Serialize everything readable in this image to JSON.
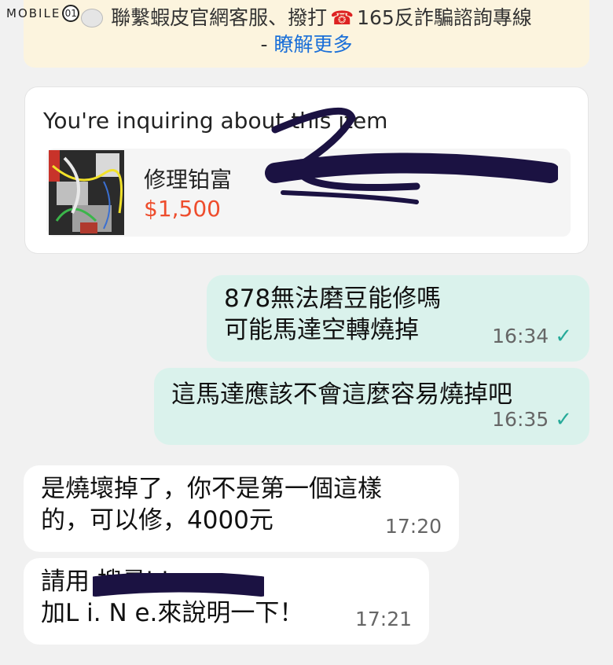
{
  "watermark": {
    "text": "MOBILE",
    "badge": "01"
  },
  "notice": {
    "line1_before": "聯繫蝦皮官網客服、撥打",
    "phone_icon": "☎",
    "line1_after": "165反詐騙諮詢專線",
    "dash": "- ",
    "link": "瞭解更多"
  },
  "item_card": {
    "heading": "You're inquiring about this item",
    "product_name": "修理铂富",
    "price": "$1,500"
  },
  "messages": [
    {
      "direction": "out",
      "text": "878無法磨豆能修嗎\n可能馬達空轉燒掉",
      "time": "16:34",
      "status": "✓"
    },
    {
      "direction": "out",
      "text": "這馬達應該不會這麼容易燒掉吧",
      "time": "16:35",
      "status": "✓"
    },
    {
      "direction": "in",
      "text": "是燒壞掉了，你不是第一個這樣\n的，可以修，4000元",
      "time": "17:20"
    },
    {
      "direction": "in",
      "text": "請用 搜尋id\n加L i. N e.來說明一下！",
      "time": "17:21"
    }
  ],
  "colors": {
    "outgoing_bubble": "#daf2ec",
    "incoming_bubble": "#ffffff",
    "price": "#ee4d2d",
    "link": "#1a6fd8",
    "check": "#26aa99",
    "redaction": "#1b1242"
  }
}
